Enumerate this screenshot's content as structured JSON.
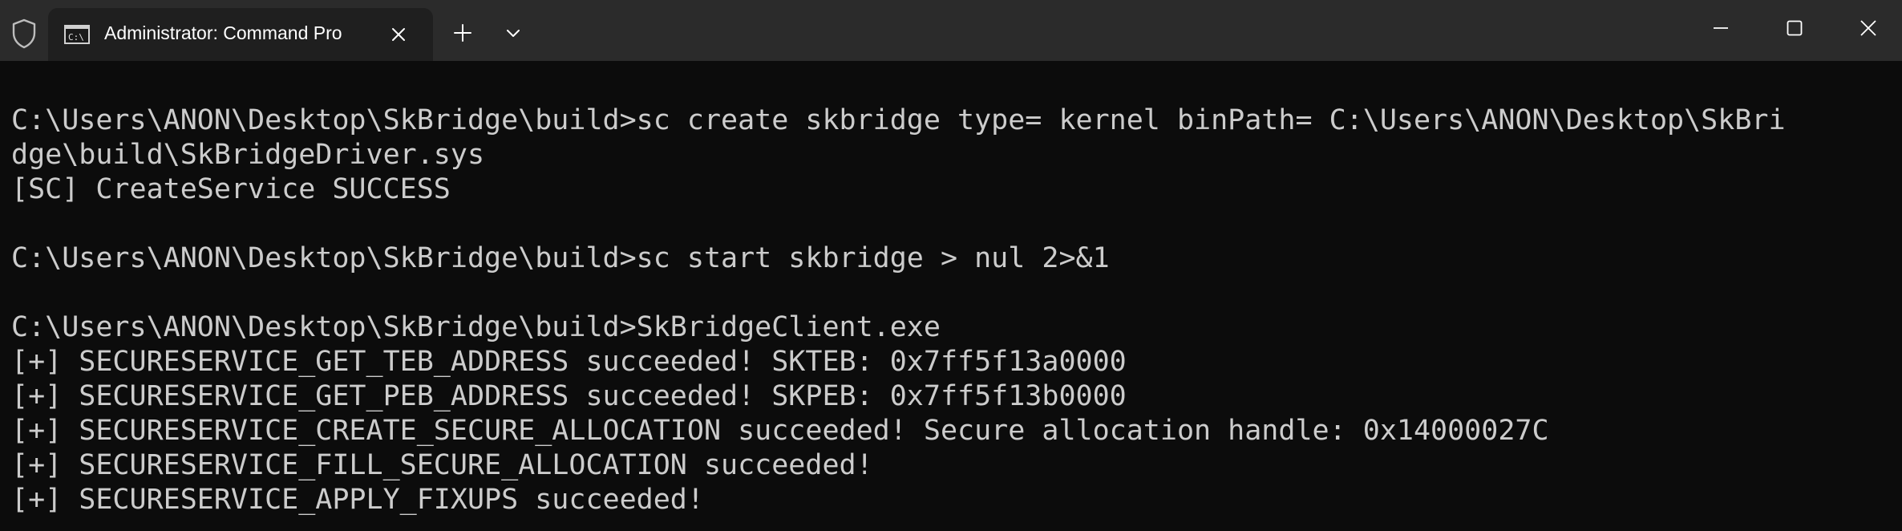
{
  "window": {
    "tab_title": "Administrator: Command Pro",
    "icons": {
      "shield": "shield-icon",
      "tab": "command-prompt-icon",
      "tab_close": "close-icon",
      "new_tab": "plus-icon",
      "dropdown": "chevron-down-icon",
      "minimize": "minimize-icon",
      "maximize": "maximize-icon",
      "close": "close-icon"
    }
  },
  "colors": {
    "background": "#0c0c0c",
    "titlebar": "#2b2b2b",
    "tab": "#1f1f1f",
    "text": "#cccccc"
  },
  "terminal": {
    "lines": [
      "C:\\Users\\ANON\\Desktop\\SkBridge\\build>sc create skbridge type= kernel binPath= C:\\Users\\ANON\\Desktop\\SkBri",
      "dge\\build\\SkBridgeDriver.sys",
      "[SC] CreateService SUCCESS",
      "",
      "C:\\Users\\ANON\\Desktop\\SkBridge\\build>sc start skbridge > nul 2>&1",
      "",
      "C:\\Users\\ANON\\Desktop\\SkBridge\\build>SkBridgeClient.exe",
      "[+] SECURESERVICE_GET_TEB_ADDRESS succeeded! SKTEB: 0x7ff5f13a0000",
      "[+] SECURESERVICE_GET_PEB_ADDRESS succeeded! SKPEB: 0x7ff5f13b0000",
      "[+] SECURESERVICE_CREATE_SECURE_ALLOCATION succeeded! Secure allocation handle: 0x14000027C",
      "[+] SECURESERVICE_FILL_SECURE_ALLOCATION succeeded!",
      "[+] SECURESERVICE_APPLY_FIXUPS succeeded!"
    ]
  }
}
